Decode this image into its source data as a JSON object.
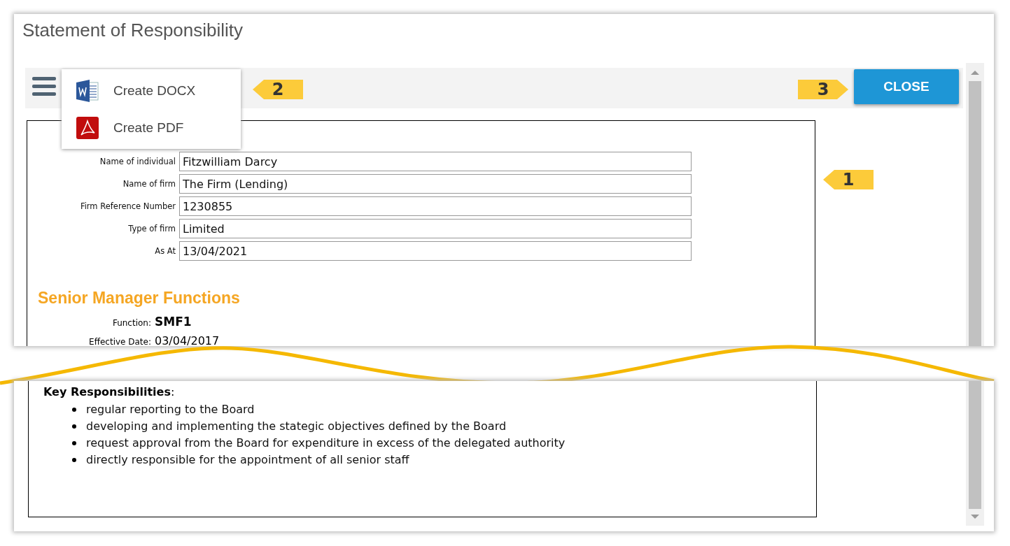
{
  "window": {
    "title": "Statement of Responsibility"
  },
  "menu": {
    "items": [
      {
        "label": "Create DOCX",
        "kind": "word"
      },
      {
        "label": "Create PDF",
        "kind": "pdf"
      }
    ]
  },
  "close_button": {
    "label": "CLOSE"
  },
  "callouts": [
    {
      "label": "2",
      "kind": "left"
    },
    {
      "label": "3",
      "kind": "right"
    },
    {
      "label": "1",
      "kind": "left"
    }
  ],
  "form": {
    "fields": [
      {
        "label": "Name of individual",
        "value": "Fitzwilliam Darcy"
      },
      {
        "label": "Name of firm",
        "value": "The Firm (Lending)"
      },
      {
        "label": "Firm Reference Number",
        "value": "1230855"
      },
      {
        "label": "Type of firm",
        "value": "Limited"
      },
      {
        "label": "As At",
        "value": "13/04/2021"
      }
    ]
  },
  "section": {
    "heading": "Senior Manager Functions",
    "details": [
      {
        "label": "Function:",
        "value": "SMF1",
        "kind": "strong"
      },
      {
        "label": "Effective Date:",
        "value": "03/04/2017",
        "kind": "plain"
      }
    ]
  },
  "responsibilities": {
    "heading": "**Key Responsibilities**:",
    "items": [
      "regular reporting to the Board",
      "developing and implementing the stategic objectives defined by the Board",
      "request approval from the Board for expenditure in excess of the delegated authority",
      "directly responsible for the appointment of all senior staff"
    ]
  }
}
